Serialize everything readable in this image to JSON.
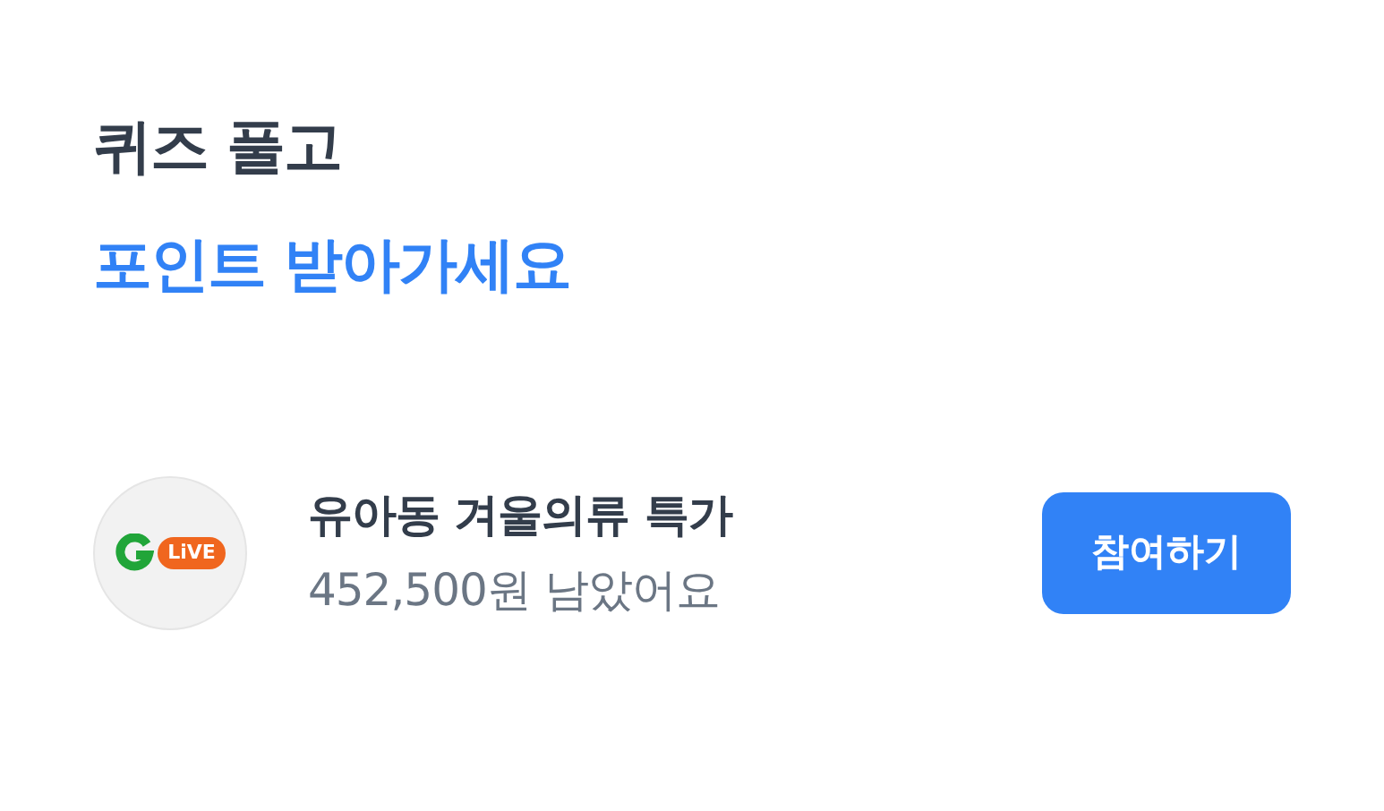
{
  "heading": {
    "line_1": "퀴즈 풀고",
    "line_2": "포인트 받아가세요"
  },
  "offer": {
    "logo_text": "LiVE",
    "title": "유아동 겨울의류 특가",
    "subtitle": "452,500원 남았어요",
    "button": "참여하기"
  }
}
